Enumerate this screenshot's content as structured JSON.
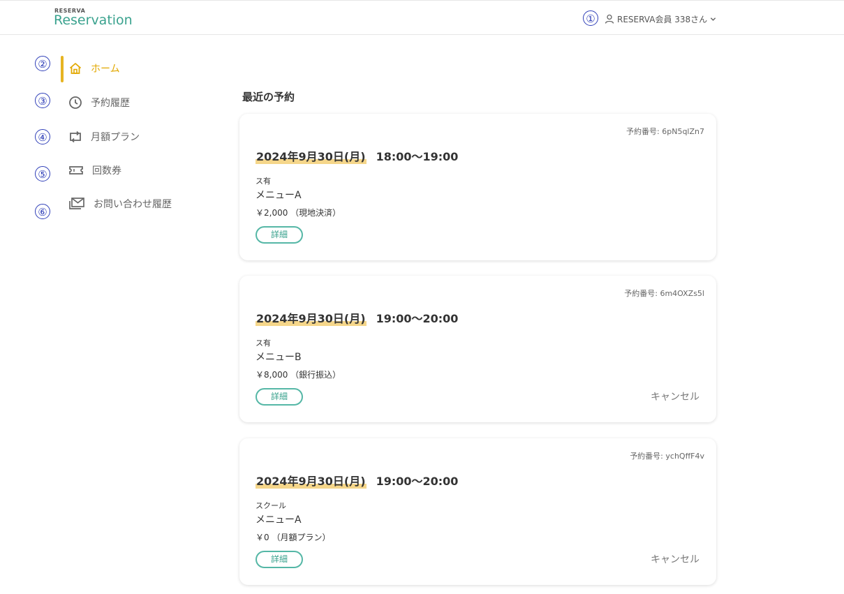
{
  "header": {
    "logo_small": "RESERVA",
    "logo_main": "Reservation",
    "user_label": "RESERVA会員 338さん",
    "icons": {
      "user": "user-icon",
      "chevron": "chevron-down-icon"
    }
  },
  "annotations": [
    "①",
    "②",
    "③",
    "④",
    "⑤",
    "⑥"
  ],
  "sidebar": {
    "items": [
      {
        "label": "ホーム",
        "icon": "home-icon",
        "active": true
      },
      {
        "label": "予約履歴",
        "icon": "clock-icon",
        "active": false
      },
      {
        "label": "月額プラン",
        "icon": "repeat-icon",
        "active": false
      },
      {
        "label": "回数券",
        "icon": "ticket-icon",
        "active": false
      },
      {
        "label": "お問い合わせ履歴",
        "icon": "mail-icon",
        "active": false
      }
    ]
  },
  "main": {
    "section_title": "最近の予約",
    "reservations": [
      {
        "number": "予約番号: 6pN5qlZn7",
        "date": "2024年9月30日(月)",
        "time": "18:00〜19:00",
        "venue": "ス有",
        "menu": "メニューA",
        "price": "￥2,000 （現地決済）",
        "detail_label": "詳細",
        "cancel_label": ""
      },
      {
        "number": "予約番号: 6m4OXZs5l",
        "date": "2024年9月30日(月)",
        "time": "19:00〜20:00",
        "venue": "ス有",
        "menu": "メニューB",
        "price": "￥8,000 （銀行振込）",
        "detail_label": "詳細",
        "cancel_label": "キャンセル"
      },
      {
        "number": "予約番号: ychQffF4v",
        "date": "2024年9月30日(月)",
        "time": "19:00〜20:00",
        "venue": "スクール",
        "menu": "メニューA",
        "price": "￥0 （月額プラン）",
        "detail_label": "詳細",
        "cancel_label": "キャンセル"
      }
    ]
  },
  "colors": {
    "accent": "#3aa28e",
    "active": "#e2a800",
    "highlight": "#f5d68a",
    "annotation": "#2f3fb8"
  }
}
